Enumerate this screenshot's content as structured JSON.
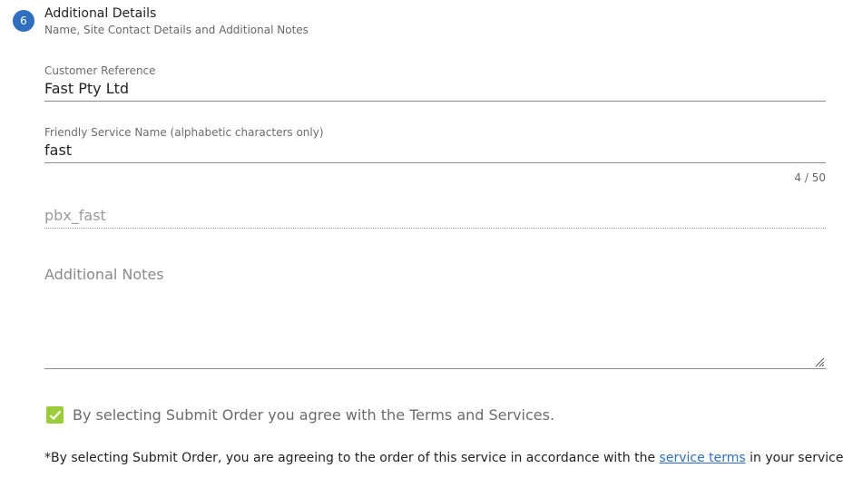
{
  "step": {
    "number": "6",
    "title": "Additional Details",
    "subtitle": "Name, Site Contact Details and Additional Notes"
  },
  "fields": {
    "customer_reference": {
      "label": "Customer Reference",
      "value": "Fast Pty Ltd"
    },
    "friendly_service_name": {
      "label": "Friendly Service Name (alphabetic characters only)",
      "value": "fast",
      "counter": "4 / 50"
    },
    "generated_name": {
      "value": "pbx_fast"
    },
    "additional_notes": {
      "placeholder": "Additional Notes",
      "value": ""
    }
  },
  "agreement": {
    "checked": true,
    "label": "By selecting Submit Order you agree with the Terms and Services.",
    "accent_color": "#9ccc3b"
  },
  "footer": {
    "text_before": "*By selecting Submit Order, you are agreeing to the order of this service in accordance with the",
    "link_text": "service terms",
    "text_after": "in your service deed."
  },
  "colors": {
    "step_badge": "#2f6fbd",
    "link": "#2f6fbd"
  }
}
